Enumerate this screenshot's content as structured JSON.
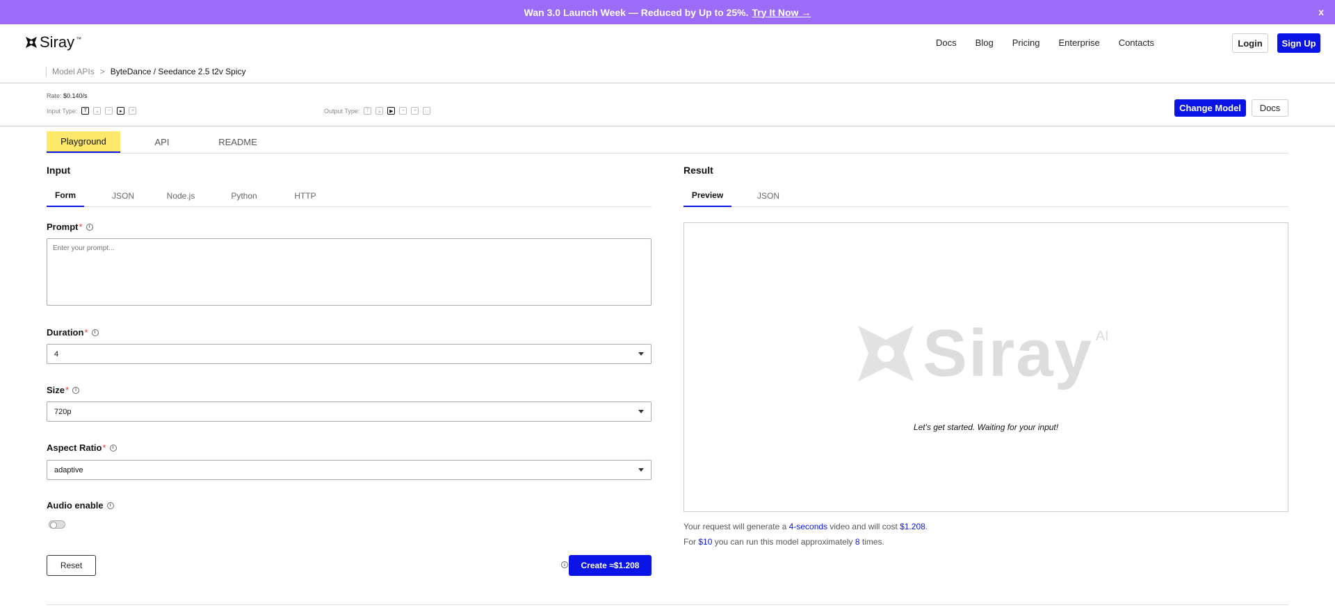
{
  "banner": {
    "text": "Wan 3.0 Launch Week — Reduced by Up to 25%.",
    "link": "Try It Now →",
    "close": "x"
  },
  "nav": {
    "logo": "Siray",
    "logo_tm": "™",
    "links": [
      "Docs",
      "Blog",
      "Pricing",
      "Enterprise",
      "Contacts"
    ],
    "login": "Login",
    "signup": "Sign Up"
  },
  "breadcrumb": {
    "parent": "Model APIs",
    "separator": ">",
    "current": "ByteDance / Seedance 2.5 t2v Spicy"
  },
  "meta": {
    "rate_label": "Rate:",
    "rate_value": "$0.140/s",
    "input_type_label": "Input Type:",
    "output_type_label": "Output Type:",
    "change_model": "Change Model",
    "docs": "Docs"
  },
  "main_tabs": [
    "Playground",
    "API",
    "README"
  ],
  "input": {
    "title": "Input",
    "tabs": [
      "Form",
      "JSON",
      "Node.js",
      "Python",
      "HTTP"
    ],
    "prompt_label": "Prompt",
    "prompt_placeholder": "Enter your prompt...",
    "duration_label": "Duration",
    "duration_value": "4",
    "size_label": "Size",
    "size_value": "720p",
    "aspect_label": "Aspect Ratio",
    "aspect_value": "adaptive",
    "audio_label": "Audio enable",
    "audio_enabled": false,
    "reset": "Reset",
    "create": "Create ≈$1.208",
    "required_mark": "*"
  },
  "result": {
    "title": "Result",
    "tabs": [
      "Preview",
      "JSON"
    ],
    "watermark": "Siray",
    "watermark_ai": "AI",
    "waiting": "Let's get started. Waiting for your input!",
    "note1_a": "Your request will generate a",
    "note1_duration": "4-seconds",
    "note1_b": "video and will cost",
    "note1_cost": "$1.208",
    "note1_c": ".",
    "note2_a": "For",
    "note2_amount": "$10",
    "note2_b": "you can run this model approximately",
    "note2_times": "8",
    "note2_c": "times."
  },
  "colors": {
    "banner": "#9d6cf6",
    "primary": "#0a14e6",
    "active_tab": "#fde86a"
  }
}
